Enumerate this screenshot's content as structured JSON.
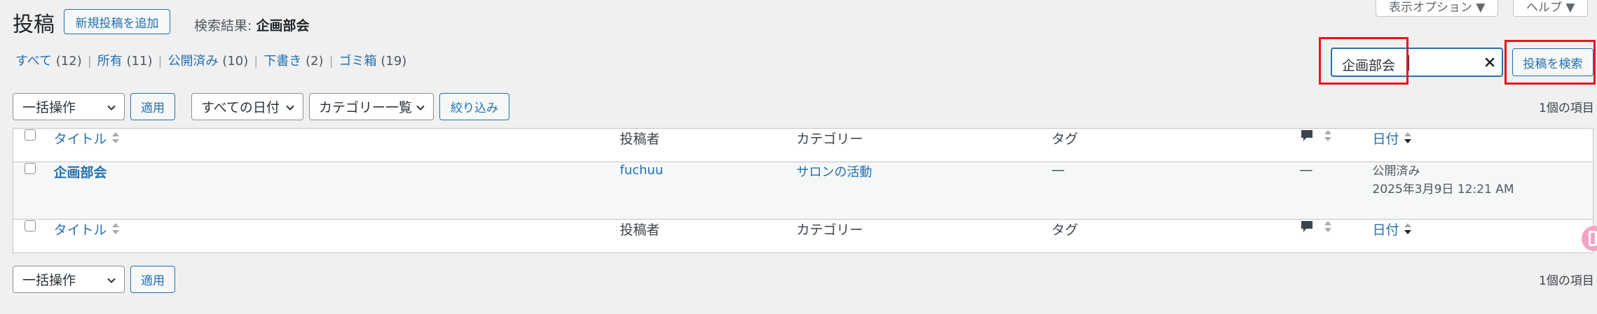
{
  "header": {
    "title": "投稿",
    "add_new_label": "新規投稿を追加",
    "search_result_prefix": "検索結果:",
    "search_result_term": "企画部会",
    "screen_options_label": "表示オプション ▼",
    "help_label": "ヘルプ ▼"
  },
  "filters": [
    {
      "label": "すべて",
      "count": "(12)"
    },
    {
      "label": "所有",
      "count": "(11)"
    },
    {
      "label": "公開済み",
      "count": "(10)"
    },
    {
      "label": "下書き",
      "count": "(2)"
    },
    {
      "label": "ゴミ箱",
      "count": "(19)"
    }
  ],
  "search": {
    "value": "企画部会",
    "clear_icon": "close-icon",
    "button_label": "投稿を検索"
  },
  "tablenav_top": {
    "bulk_action": "一括操作",
    "apply": "適用",
    "date_filter": "すべての日付",
    "category_filter": "カテゴリー一覧",
    "filter_button": "絞り込み",
    "items_count": "1個の項目"
  },
  "tablenav_bottom": {
    "bulk_action": "一括操作",
    "apply": "適用",
    "items_count": "1個の項目"
  },
  "table": {
    "columns": {
      "title": "タイトル",
      "author": "投稿者",
      "categories": "カテゴリー",
      "tags": "タグ",
      "comments_icon": "comment-bubble-icon",
      "date": "日付"
    },
    "rows": [
      {
        "title": "企画部会",
        "author": "fuchuu",
        "category": "サロンの活動",
        "tags": "—",
        "comments": "—",
        "status": "公開済み",
        "date": "2025年3月9日 12:21 AM"
      }
    ]
  },
  "colors": {
    "accent": "#2271b1",
    "highlight_box": "#e8141b",
    "background": "#f0f0f1"
  }
}
